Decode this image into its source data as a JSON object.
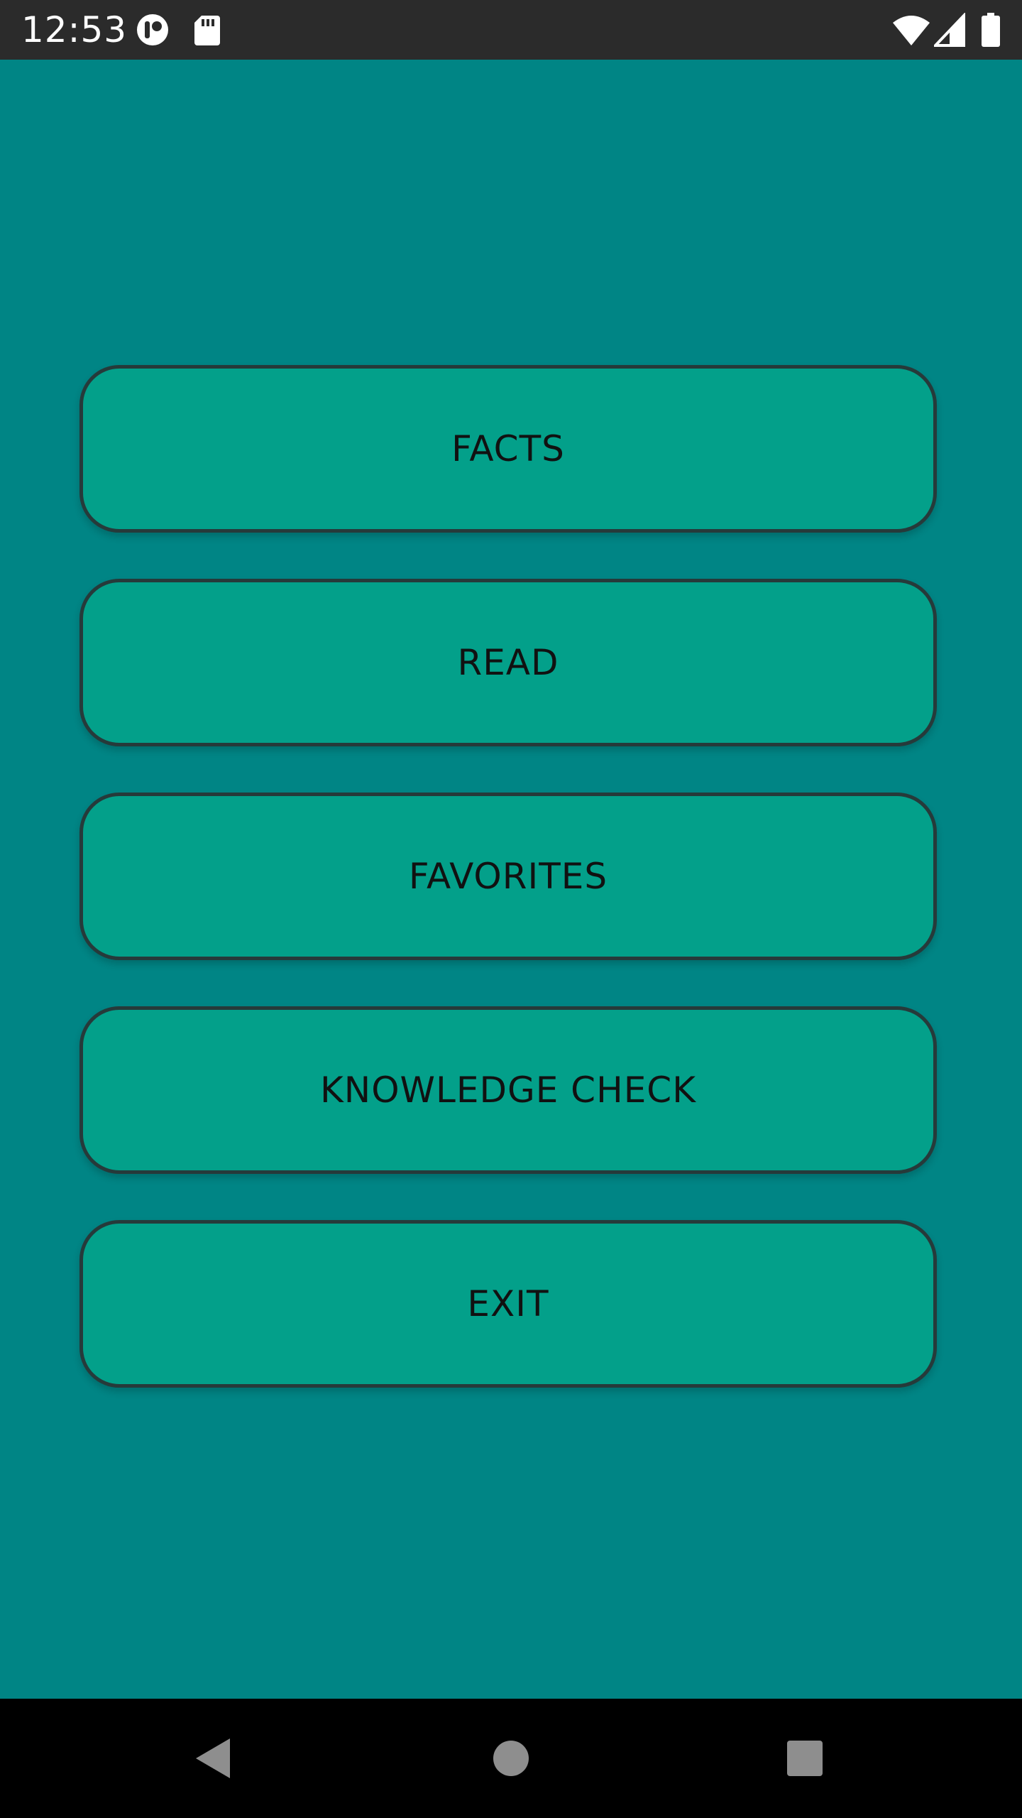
{
  "status_bar": {
    "time": "12:53",
    "icons": [
      "app-notification-icon",
      "sd-card-icon",
      "wifi-icon",
      "cell-signal-icon",
      "battery-icon"
    ]
  },
  "menu": {
    "buttons": [
      {
        "label": "FACTS"
      },
      {
        "label": "READ"
      },
      {
        "label": "FAVORITES"
      },
      {
        "label": "KNOWLEDGE CHECK"
      },
      {
        "label": "EXIT"
      }
    ]
  },
  "nav_bar": {
    "icons": [
      "back-icon",
      "home-icon",
      "recents-icon"
    ]
  },
  "colors": {
    "background": "#008585",
    "button_fill": "#03a08a",
    "button_border": "#263a3a",
    "status_bar": "#2b2b2b",
    "nav_bar": "#000000"
  }
}
